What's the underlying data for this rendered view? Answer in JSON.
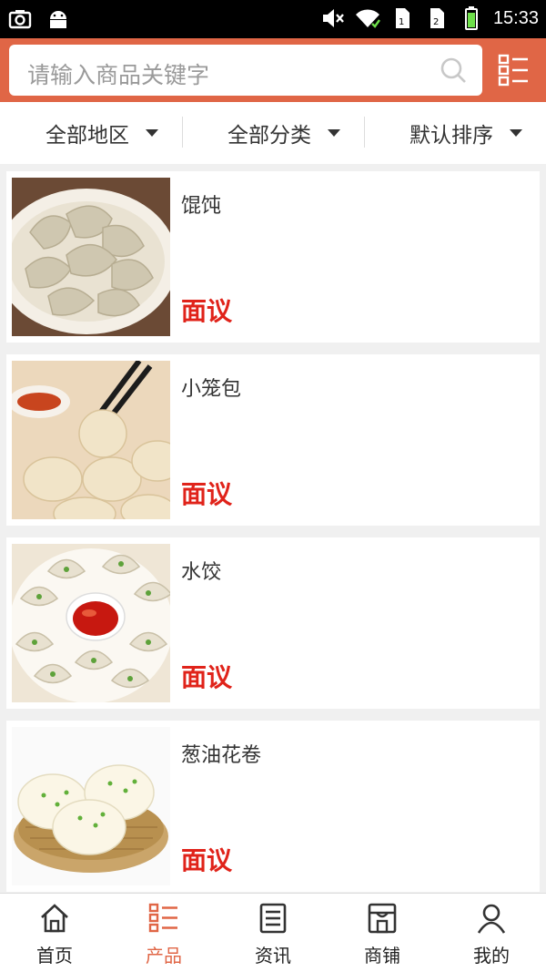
{
  "status_bar": {
    "time": "15:33"
  },
  "search": {
    "placeholder": "请输入商品关键字"
  },
  "filters": [
    {
      "label": "全部地区"
    },
    {
      "label": "全部分类"
    },
    {
      "label": "默认排序"
    }
  ],
  "products": [
    {
      "name": "馄饨",
      "price": "面议"
    },
    {
      "name": "小笼包",
      "price": "面议"
    },
    {
      "name": "水饺",
      "price": "面议"
    },
    {
      "name": "葱油花卷",
      "price": "面议"
    }
  ],
  "bottom_nav": [
    {
      "label": "首页",
      "icon": "home-icon"
    },
    {
      "label": "产品",
      "icon": "list-icon",
      "active": true
    },
    {
      "label": "资讯",
      "icon": "news-icon"
    },
    {
      "label": "商铺",
      "icon": "store-icon"
    },
    {
      "label": "我的",
      "icon": "user-icon"
    }
  ],
  "colors": {
    "accent": "#e06646",
    "price": "#e0231a"
  }
}
